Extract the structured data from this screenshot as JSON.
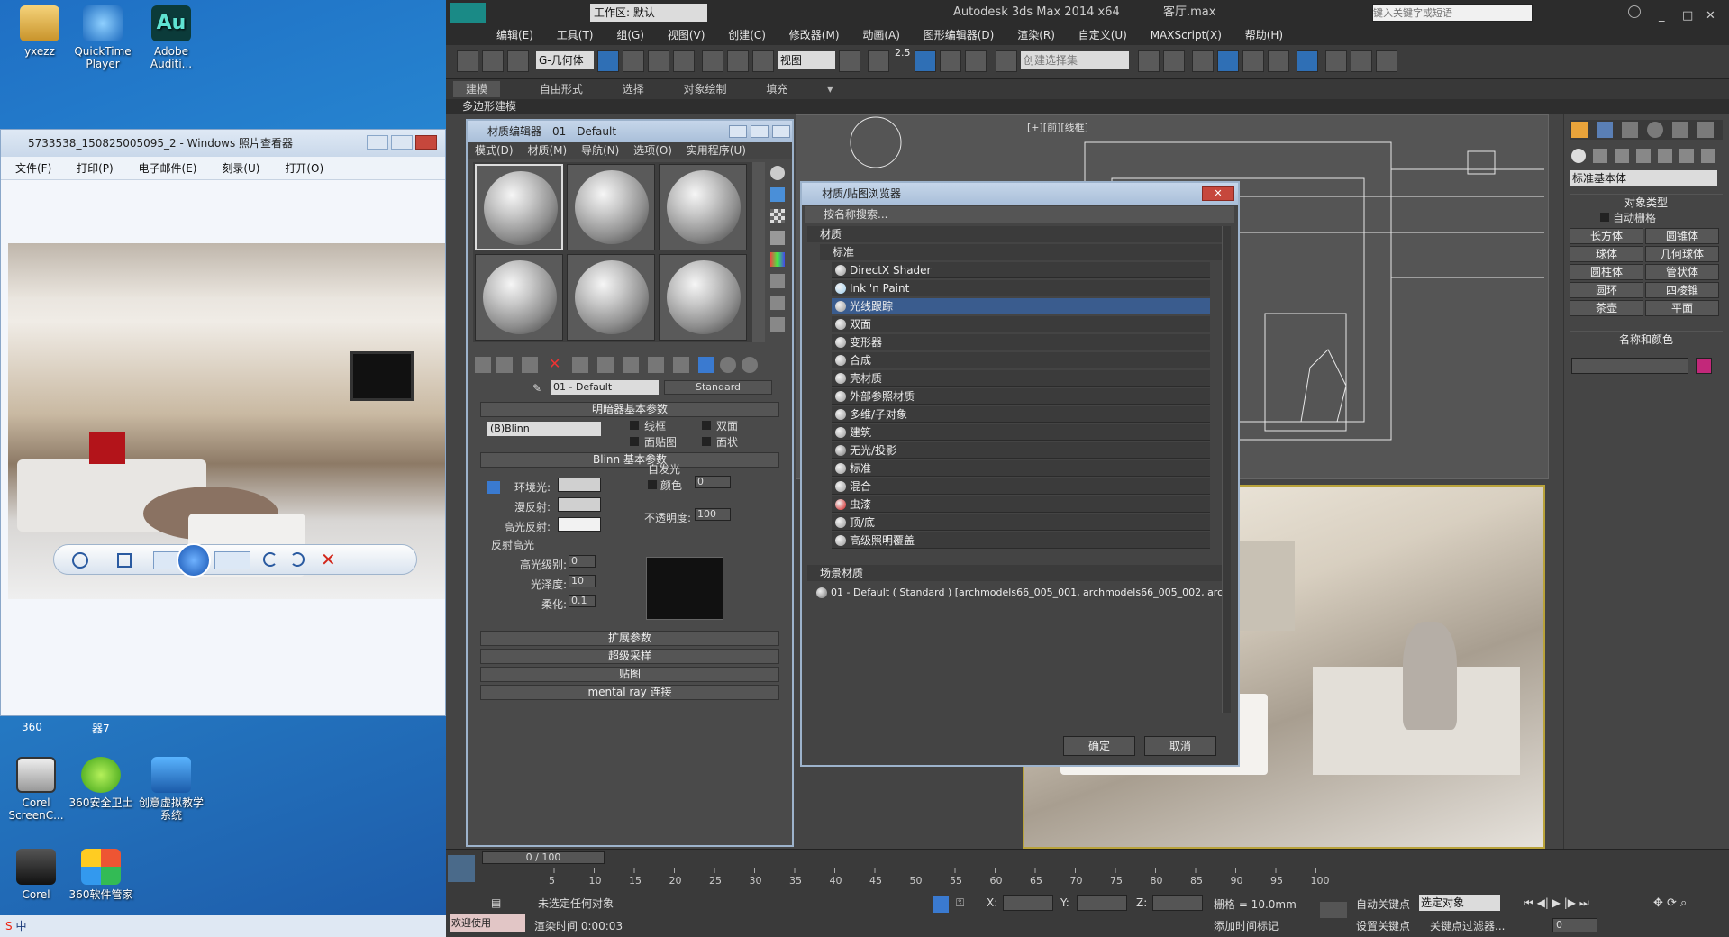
{
  "desktop": {
    "icons": [
      {
        "label": "yxezz",
        "name": "user-folder"
      },
      {
        "label": "QuickTime Player",
        "name": "quicktime"
      },
      {
        "label": "Adobe Auditi...",
        "name": "audition"
      },
      {
        "label": "Corel ScreenC...",
        "name": "corel-screencap"
      },
      {
        "label": "360安全卫士",
        "name": "360-guard"
      },
      {
        "label": "创意虚拟教学系统",
        "name": "virtual-teaching"
      },
      {
        "label": "Corel",
        "name": "corel"
      },
      {
        "label": "360软件管家",
        "name": "360-software"
      }
    ],
    "fragment_labels": [
      "360",
      "器7"
    ]
  },
  "photo_viewer": {
    "title": "5733538_150825005095_2 - Windows 照片查看器",
    "menu": [
      "文件(F)",
      "打印(P)",
      "电子邮件(E)",
      "刻录(U)",
      "打开(O)"
    ]
  },
  "tray": {
    "text": "中"
  },
  "max": {
    "title": "Autodesk 3ds Max  2014 x64",
    "file": "客厅.max",
    "workspace": "工作区: 默认",
    "search_placeholder": "键入关键字或短语",
    "menu": [
      "编辑(E)",
      "工具(T)",
      "组(G)",
      "视图(V)",
      "创建(C)",
      "修改器(M)",
      "动画(A)",
      "图形编辑器(D)",
      "渲染(R)",
      "自定义(U)",
      "MAXScript(X)",
      "帮助(H)"
    ],
    "toolbar": {
      "filter": "G-几何体",
      "view": "视图",
      "snap_value": "2.5",
      "named_sel": "创建选择集"
    },
    "ribbon_tabs": [
      "建模",
      "自由形式",
      "选择",
      "对象绘制",
      "填充"
    ],
    "poly_label": "多边形建模",
    "viewport_label": "[+][前][线框]",
    "command_panel": {
      "dropdown": "标准基本体",
      "section_type": "对象类型",
      "autogrid": "自动栅格",
      "buttons": [
        "长方体",
        "圆锥体",
        "球体",
        "几何球体",
        "圆柱体",
        "管状体",
        "圆环",
        "四棱锥",
        "茶壶",
        "平面"
      ],
      "section_name": "名称和颜色"
    },
    "timeline": {
      "frame": "0 / 100",
      "ticks": [
        "5",
        "10",
        "15",
        "20",
        "25",
        "30",
        "35",
        "40",
        "45",
        "50",
        "55",
        "60",
        "65",
        "70",
        "75",
        "80",
        "85",
        "90",
        "95",
        "100"
      ]
    },
    "status": {
      "welcome": "欢迎使用 MAXSc",
      "none_selected": "未选定任何对象",
      "render_time": "渲染时间 0:00:03",
      "x_label": "X:",
      "y_label": "Y:",
      "z_label": "Z:",
      "grid": "栅格 = 10.0mm",
      "auto_key": "自动关键点",
      "set_key": "设置关键点",
      "selected": "选定对象",
      "key_filters": "关键点过滤器...",
      "add_time_tag": "添加时间标记",
      "frame_value": "0"
    }
  },
  "material_editor": {
    "title": "材质编辑器 - 01 - Default",
    "menu": [
      "模式(D)",
      "材质(M)",
      "导航(N)",
      "选项(O)",
      "实用程序(U)"
    ],
    "material_name": "01 - Default",
    "material_type": "Standard",
    "rollouts": {
      "shader_basic": "明暗器基本参数",
      "shader": "(B)Blinn",
      "wire": "线框",
      "two_sided": "双面",
      "face_map": "面贴图",
      "faceted": "面状",
      "blinn_basic": "Blinn 基本参数",
      "self_illum": "自发光",
      "color": "颜色",
      "color_value": "0",
      "ambient": "环境光:",
      "diffuse": "漫反射:",
      "specular": "高光反射:",
      "opacity": "不透明度:",
      "opacity_value": "100",
      "spec_highlights": "反射高光",
      "spec_level": "高光级别:",
      "spec_level_value": "0",
      "gloss": "光泽度:",
      "gloss_value": "10",
      "soften": "柔化:",
      "soften_value": "0.1",
      "extended": "扩展参数",
      "supersampling": "超级采样",
      "maps": "贴图",
      "mental_ray": "mental ray 连接"
    }
  },
  "browser": {
    "title": "材质/贴图浏览器",
    "search": "按名称搜索...",
    "group_materials": "材质",
    "group_standard": "标准",
    "items": [
      {
        "label": "DirectX Shader",
        "color": "#9a9a9a"
      },
      {
        "label": "Ink 'n Paint",
        "color": "#9fd0f0"
      },
      {
        "label": "光线跟踪",
        "color": "#9a9a9a"
      },
      {
        "label": "双面",
        "color": "#9a9a9a"
      },
      {
        "label": "变形器",
        "color": "#9a9a9a"
      },
      {
        "label": "合成",
        "color": "#9a9a9a"
      },
      {
        "label": "壳材质",
        "color": "#9a9a9a"
      },
      {
        "label": "外部参照材质",
        "color": "#9a9a9a"
      },
      {
        "label": "多维/子对象",
        "color": "#9a9a9a"
      },
      {
        "label": "建筑",
        "color": "#9a9a9a"
      },
      {
        "label": "无光/投影",
        "color": "#777777"
      },
      {
        "label": "标准",
        "color": "#9a9a9a"
      },
      {
        "label": "混合",
        "color": "#9a9a9a"
      },
      {
        "label": "虫漆",
        "color": "#d01818"
      },
      {
        "label": "顶/底",
        "color": "#9a9a9a"
      },
      {
        "label": "高级照明覆盖",
        "color": "#9a9a9a"
      }
    ],
    "selected_index": 2,
    "group_scene": "场景材质",
    "scene_item": "01 - Default  ( Standard ) [archmodels66_005_001, archmodels66_005_002, arc...",
    "ok": "确定",
    "cancel": "取消"
  }
}
